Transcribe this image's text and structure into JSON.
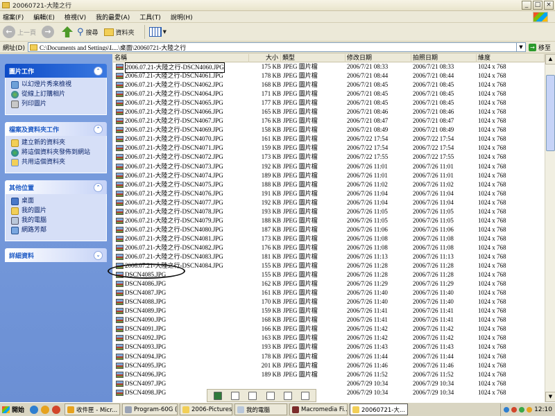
{
  "window": {
    "title": "20060721-大陸之行"
  },
  "window_buttons": {
    "minimize": "_",
    "maximize": "□",
    "close": "×"
  },
  "menu": {
    "items": [
      "檔案(F)",
      "編輯(E)",
      "檢視(V)",
      "我的最愛(A)",
      "工具(T)",
      "說明(H)"
    ]
  },
  "toolbar": {
    "back": "上一頁",
    "search": "搜尋",
    "folders": "資料夾"
  },
  "address": {
    "label": "網址(D)",
    "value": "C:\\Documents and Settings\\L...\\桌面\\20060721-大陸之行",
    "go": "移至"
  },
  "tasks": {
    "picture": {
      "title": "圖片工作",
      "items": [
        "以幻燈片秀來檢視",
        "從線上訂購相片",
        "列印圖片"
      ]
    },
    "file": {
      "title": "檔案及資料夾工作",
      "items": [
        "建立新的資料夾",
        "將這個資料夾發佈到網站",
        "共用這個資料夾"
      ]
    },
    "other": {
      "title": "其他位置",
      "items": [
        "桌面",
        "我的圖片",
        "我的電腦",
        "網路芳鄰"
      ]
    },
    "details": {
      "title": "詳細資料"
    }
  },
  "columns": {
    "name": "名稱",
    "size": "大小",
    "type": "類型",
    "modified": "修改日期",
    "taken": "拍照日期",
    "dimensions": "維度"
  },
  "files": [
    {
      "name": "2006.07.21-大陸之行-DSCN4060.JPG",
      "size": "175 KB",
      "type": "JPEG 圖片檔",
      "modified": "2006/7/21 08:33",
      "taken": "2006/7/21 08:33",
      "dim": "1024 x 768"
    },
    {
      "name": "2006.07.21-大陸之行-DSCN4061.JPG",
      "size": "178 KB",
      "type": "JPEG 圖片檔",
      "modified": "2006/7/21 08:44",
      "taken": "2006/7/21 08:44",
      "dim": "1024 x 768"
    },
    {
      "name": "2006.07.21-大陸之行-DSCN4062.JPG",
      "size": "168 KB",
      "type": "JPEG 圖片檔",
      "modified": "2006/7/21 08:45",
      "taken": "2006/7/21 08:45",
      "dim": "1024 x 768"
    },
    {
      "name": "2006.07.21-大陸之行-DSCN4064.JPG",
      "size": "171 KB",
      "type": "JPEG 圖片檔",
      "modified": "2006/7/21 08:45",
      "taken": "2006/7/21 08:45",
      "dim": "1024 x 768"
    },
    {
      "name": "2006.07.21-大陸之行-DSCN4065.JPG",
      "size": "177 KB",
      "type": "JPEG 圖片檔",
      "modified": "2006/7/21 08:45",
      "taken": "2006/7/21 08:45",
      "dim": "1024 x 768"
    },
    {
      "name": "2006.07.21-大陸之行-DSCN4066.JPG",
      "size": "165 KB",
      "type": "JPEG 圖片檔",
      "modified": "2006/7/21 08:46",
      "taken": "2006/7/21 08:46",
      "dim": "1024 x 768"
    },
    {
      "name": "2006.07.21-大陸之行-DSCN4067.JPG",
      "size": "176 KB",
      "type": "JPEG 圖片檔",
      "modified": "2006/7/21 08:47",
      "taken": "2006/7/21 08:47",
      "dim": "1024 x 768"
    },
    {
      "name": "2006.07.21-大陸之行-DSCN4069.JPG",
      "size": "158 KB",
      "type": "JPEG 圖片檔",
      "modified": "2006/7/21 08:49",
      "taken": "2006/7/21 08:49",
      "dim": "1024 x 768"
    },
    {
      "name": "2006.07.21-大陸之行-DSCN4070.JPG",
      "size": "161 KB",
      "type": "JPEG 圖片檔",
      "modified": "2006/7/22 17:54",
      "taken": "2006/7/22 17:54",
      "dim": "1024 x 768"
    },
    {
      "name": "2006.07.21-大陸之行-DSCN4071.JPG",
      "size": "159 KB",
      "type": "JPEG 圖片檔",
      "modified": "2006/7/22 17:54",
      "taken": "2006/7/22 17:54",
      "dim": "1024 x 768"
    },
    {
      "name": "2006.07.21-大陸之行-DSCN4072.JPG",
      "size": "173 KB",
      "type": "JPEG 圖片檔",
      "modified": "2006/7/22 17:55",
      "taken": "2006/7/22 17:55",
      "dim": "1024 x 768"
    },
    {
      "name": "2006.07.21-大陸之行-DSCN4073.JPG",
      "size": "192 KB",
      "type": "JPEG 圖片檔",
      "modified": "2006/7/26 11:01",
      "taken": "2006/7/26 11:01",
      "dim": "1024 x 768"
    },
    {
      "name": "2006.07.21-大陸之行-DSCN4074.JPG",
      "size": "189 KB",
      "type": "JPEG 圖片檔",
      "modified": "2006/7/26 11:01",
      "taken": "2006/7/26 11:01",
      "dim": "1024 x 768"
    },
    {
      "name": "2006.07.21-大陸之行-DSCN4075.JPG",
      "size": "188 KB",
      "type": "JPEG 圖片檔",
      "modified": "2006/7/26 11:02",
      "taken": "2006/7/26 11:02",
      "dim": "1024 x 768"
    },
    {
      "name": "2006.07.21-大陸之行-DSCN4076.JPG",
      "size": "191 KB",
      "type": "JPEG 圖片檔",
      "modified": "2006/7/26 11:04",
      "taken": "2006/7/26 11:04",
      "dim": "1024 x 768"
    },
    {
      "name": "2006.07.21-大陸之行-DSCN4077.JPG",
      "size": "192 KB",
      "type": "JPEG 圖片檔",
      "modified": "2006/7/26 11:04",
      "taken": "2006/7/26 11:04",
      "dim": "1024 x 768"
    },
    {
      "name": "2006.07.21-大陸之行-DSCN4078.JPG",
      "size": "193 KB",
      "type": "JPEG 圖片檔",
      "modified": "2006/7/26 11:05",
      "taken": "2006/7/26 11:05",
      "dim": "1024 x 768"
    },
    {
      "name": "2006.07.21-大陸之行-DSCN4079.JPG",
      "size": "188 KB",
      "type": "JPEG 圖片檔",
      "modified": "2006/7/26 11:05",
      "taken": "2006/7/26 11:05",
      "dim": "1024 x 768"
    },
    {
      "name": "2006.07.21-大陸之行-DSCN4080.JPG",
      "size": "187 KB",
      "type": "JPEG 圖片檔",
      "modified": "2006/7/26 11:06",
      "taken": "2006/7/26 11:06",
      "dim": "1024 x 768"
    },
    {
      "name": "2006.07.21-大陸之行-DSCN4081.JPG",
      "size": "173 KB",
      "type": "JPEG 圖片檔",
      "modified": "2006/7/26 11:08",
      "taken": "2006/7/26 11:08",
      "dim": "1024 x 768"
    },
    {
      "name": "2006.07.21-大陸之行-DSCN4082.JPG",
      "size": "176 KB",
      "type": "JPEG 圖片檔",
      "modified": "2006/7/26 11:08",
      "taken": "2006/7/26 11:08",
      "dim": "1024 x 768"
    },
    {
      "name": "2006.07.21-大陸之行-DSCN4083.JPG",
      "size": "181 KB",
      "type": "JPEG 圖片檔",
      "modified": "2006/7/26 11:13",
      "taken": "2006/7/26 11:13",
      "dim": "1024 x 768"
    },
    {
      "name": "2006.07.21-大陸之行-DSCN4084.JPG",
      "size": "155 KB",
      "type": "JPEG 圖片檔",
      "modified": "2006/7/26 11:28",
      "taken": "2006/7/26 11:28",
      "dim": "1024 x 768"
    },
    {
      "name": "DSCN4085.JPG",
      "size": "155 KB",
      "type": "JPEG 圖片檔",
      "modified": "2006/7/26 11:28",
      "taken": "2006/7/26 11:28",
      "dim": "1024 x 768"
    },
    {
      "name": "DSCN4086.JPG",
      "size": "162 KB",
      "type": "JPEG 圖片檔",
      "modified": "2006/7/26 11:29",
      "taken": "2006/7/26 11:29",
      "dim": "1024 x 768"
    },
    {
      "name": "DSCN4087.JPG",
      "size": "161 KB",
      "type": "JPEG 圖片檔",
      "modified": "2006/7/26 11:40",
      "taken": "2006/7/26 11:40",
      "dim": "1024 x 768"
    },
    {
      "name": "DSCN4088.JPG",
      "size": "170 KB",
      "type": "JPEG 圖片檔",
      "modified": "2006/7/26 11:40",
      "taken": "2006/7/26 11:40",
      "dim": "1024 x 768"
    },
    {
      "name": "DSCN4089.JPG",
      "size": "159 KB",
      "type": "JPEG 圖片檔",
      "modified": "2006/7/26 11:41",
      "taken": "2006/7/26 11:41",
      "dim": "1024 x 768"
    },
    {
      "name": "DSCN4090.JPG",
      "size": "168 KB",
      "type": "JPEG 圖片檔",
      "modified": "2006/7/26 11:41",
      "taken": "2006/7/26 11:41",
      "dim": "1024 x 768"
    },
    {
      "name": "DSCN4091.JPG",
      "size": "166 KB",
      "type": "JPEG 圖片檔",
      "modified": "2006/7/26 11:42",
      "taken": "2006/7/26 11:42",
      "dim": "1024 x 768"
    },
    {
      "name": "DSCN4092.JPG",
      "size": "163 KB",
      "type": "JPEG 圖片檔",
      "modified": "2006/7/26 11:42",
      "taken": "2006/7/26 11:42",
      "dim": "1024 x 768"
    },
    {
      "name": "DSCN4093.JPG",
      "size": "193 KB",
      "type": "JPEG 圖片檔",
      "modified": "2006/7/26 11:43",
      "taken": "2006/7/26 11:43",
      "dim": "1024 x 768"
    },
    {
      "name": "DSCN4094.JPG",
      "size": "178 KB",
      "type": "JPEG 圖片檔",
      "modified": "2006/7/26 11:44",
      "taken": "2006/7/26 11:44",
      "dim": "1024 x 768"
    },
    {
      "name": "DSCN4095.JPG",
      "size": "201 KB",
      "type": "JPEG 圖片檔",
      "modified": "2006/7/26 11:46",
      "taken": "2006/7/26 11:46",
      "dim": "1024 x 768"
    },
    {
      "name": "DSCN4096.JPG",
      "size": "189 KB",
      "type": "JPEG 圖片檔",
      "modified": "2006/7/26 11:52",
      "taken": "2006/7/26 11:52",
      "dim": "1024 x 768"
    },
    {
      "name": "DSCN4097.JPG",
      "size": "",
      "type": "",
      "modified": "2006/7/29 10:34",
      "taken": "2006/7/29 10:34",
      "dim": "1024 x 768"
    },
    {
      "name": "DSCN4098.JPG",
      "size": "",
      "type": "",
      "modified": "2006/7/29 10:34",
      "taken": "2006/7/29 10:34",
      "dim": "1024 x 768"
    }
  ],
  "taskbar": {
    "start": "開始",
    "buttons": [
      "收件匣 - Micr...",
      "Program-60G (...",
      "2006-Pictures",
      "我的電腦",
      "Macromedia Fi...",
      "20060721-大..."
    ],
    "clock": "12:10"
  },
  "colors": {
    "taskpane": "#6b8fd4",
    "selection_outline": "#000000",
    "xp_chrome": "#ece9d8"
  }
}
